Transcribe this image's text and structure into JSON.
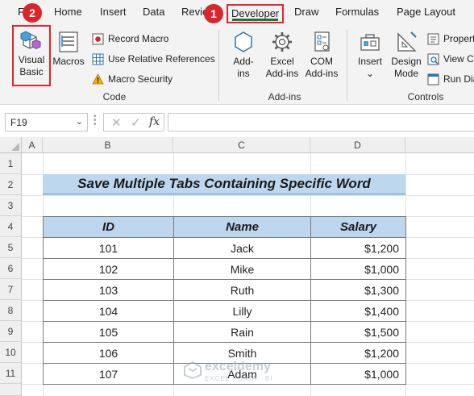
{
  "ribbon_tabs": {
    "file": "F",
    "home": "Home",
    "insert": "Insert",
    "data": "Data",
    "review": "Revie",
    "developer": "Developer",
    "draw": "Draw",
    "formulas": "Formulas",
    "page_layout": "Page Layout"
  },
  "badges": {
    "developer_step": "1",
    "visual_basic_step": "2"
  },
  "code_group": {
    "label": "Code",
    "visual_basic": "Visual Basic",
    "visual_basic_line1": "Visual",
    "visual_basic_line2": "Basic",
    "macros": "Macros",
    "record_macro": "Record Macro",
    "use_relative_references": "Use Relative References",
    "macro_security": "Macro Security"
  },
  "addins_group": {
    "label": "Add-ins",
    "addins_line1": "Add-",
    "addins_line2": "ins",
    "excel_addins_line1": "Excel",
    "excel_addins_line2": "Add-ins",
    "com_addins_line1": "COM",
    "com_addins_line2": "Add-ins"
  },
  "controls_group": {
    "label": "Controls",
    "insert": "Insert",
    "insert_chevron": "⌄",
    "design_mode_line1": "Design",
    "design_mode_line2": "Mode",
    "properties": "Propert",
    "view_code": "View C",
    "run_dialog": "Run Dia"
  },
  "formula_bar": {
    "name_box": "F19",
    "name_box_chevron": "⌄",
    "cancel_glyph": "✕",
    "enter_glyph": "✓",
    "fx_glyph": "fx",
    "formula": ""
  },
  "sheet": {
    "columns": [
      "A",
      "B",
      "C",
      "D"
    ],
    "rows": [
      "1",
      "2",
      "3",
      "4",
      "5",
      "6",
      "7",
      "8",
      "9",
      "10",
      "11"
    ],
    "title": "Save Multiple Tabs Containing Specific Word",
    "headers": {
      "id": "ID",
      "name": "Name",
      "salary": "Salary"
    },
    "records": [
      {
        "id": "101",
        "name": "Jack",
        "salary": "$1,200"
      },
      {
        "id": "102",
        "name": "Mike",
        "salary": "$1,000"
      },
      {
        "id": "103",
        "name": "Ruth",
        "salary": "$1,300"
      },
      {
        "id": "104",
        "name": "Lilly",
        "salary": "$1,400"
      },
      {
        "id": "105",
        "name": "Rain",
        "salary": "$1,500"
      },
      {
        "id": "106",
        "name": "Smith",
        "salary": "$1,200"
      },
      {
        "id": "107",
        "name": "Adam",
        "salary": "$1,000"
      }
    ]
  },
  "watermark": {
    "name": "exceldemy",
    "tagline": "EXCEL · DATA · BI"
  },
  "colors": {
    "highlight_red": "#e0252b",
    "badge_red": "#d9262b",
    "header_blue": "#bdd7ee",
    "excel_green": "#217346"
  },
  "icons": {
    "visual_basic": "visual-basic-cube-icon",
    "macros": "macros-list-icon",
    "record_macro": "record-macro-icon",
    "relative_references": "grid-table-icon",
    "macro_security": "warning-triangle-icon",
    "addins": "hexagon-addin-icon",
    "excel_addins": "gear-icon",
    "com_addins": "com-addins-icon",
    "insert_controls": "toolbox-icon",
    "design_mode": "ruler-triangle-icon",
    "properties": "properties-icon",
    "view_code": "view-code-icon",
    "run_dialog": "run-dialog-icon"
  }
}
